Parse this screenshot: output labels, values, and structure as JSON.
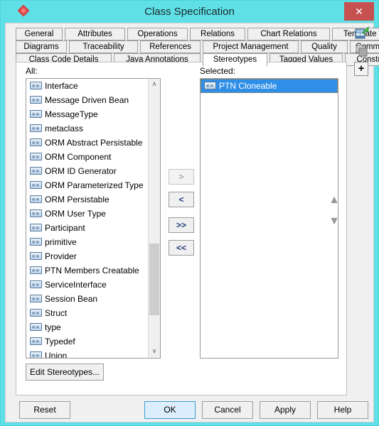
{
  "window": {
    "title": "Class Specification",
    "close_label": "✕",
    "app_icon": "diamond-logo-icon",
    "titlebar_color": "#5EE0E6",
    "accent_color": "#2F8FE8"
  },
  "tabs": {
    "row1": [
      {
        "label": "General",
        "active": false
      },
      {
        "label": "Attributes",
        "active": false
      },
      {
        "label": "Operations",
        "active": false
      },
      {
        "label": "Relations",
        "active": false
      },
      {
        "label": "Chart Relations",
        "active": false
      },
      {
        "label": "Template Parameters",
        "active": false
      }
    ],
    "row2": [
      {
        "label": "Diagrams",
        "active": false
      },
      {
        "label": "Traceability",
        "active": false
      },
      {
        "label": "References",
        "active": false
      },
      {
        "label": "Project Management",
        "active": false
      },
      {
        "label": "Quality",
        "active": false
      },
      {
        "label": "Comments",
        "active": false
      }
    ],
    "row3": [
      {
        "label": "Class Code Details",
        "active": false
      },
      {
        "label": "Java Annotations",
        "active": false
      },
      {
        "label": "Stereotypes",
        "active": true
      },
      {
        "label": "Tagged Values",
        "active": false
      },
      {
        "label": "Constraints",
        "active": false
      }
    ]
  },
  "sidetools": [
    {
      "name": "new-specification-icon",
      "tooltip": "New"
    },
    {
      "name": "copy-specification-icon",
      "tooltip": "Copy"
    },
    {
      "name": "add-icon",
      "label": "+"
    }
  ],
  "panel": {
    "all_label": "All:",
    "selected_label": "Selected:",
    "all_items": [
      "Interface",
      "Message Driven Bean",
      "MessageType",
      "metaclass",
      "ORM Abstract Persistable",
      "ORM Component",
      "ORM ID Generator",
      "ORM Parameterized Type",
      "ORM Persistable",
      "ORM User Type",
      "Participant",
      "primitive",
      "Provider",
      "PTN Members Creatable",
      "ServiceInterface",
      "Session Bean",
      "Struct",
      "type",
      "Typedef",
      "Union"
    ],
    "selected_items": [
      "PTN Cloneable"
    ],
    "item_icon": "stereotype-guillemet-icon",
    "item_icon_glyph": "«»",
    "scrollbar": {
      "up_glyph": "∧",
      "down_glyph": "∨",
      "thumb_top_pct": 60,
      "thumb_height_pct": 28
    },
    "transfer_buttons": [
      {
        "name": "move-right",
        "label": ">",
        "disabled": true
      },
      {
        "name": "move-left",
        "label": "<",
        "disabled": false
      },
      {
        "name": "move-all-right",
        "label": ">>",
        "disabled": false
      },
      {
        "name": "move-all-left",
        "label": "<<",
        "disabled": false
      }
    ],
    "order_buttons": [
      {
        "name": "move-up",
        "glyph": "▲",
        "disabled": true
      },
      {
        "name": "move-down",
        "glyph": "▼",
        "disabled": true
      }
    ],
    "edit_stereotypes_label": "Edit Stereotypes..."
  },
  "footer": {
    "reset_label": "Reset",
    "ok_label": "OK",
    "cancel_label": "Cancel",
    "apply_label": "Apply",
    "help_label": "Help"
  }
}
